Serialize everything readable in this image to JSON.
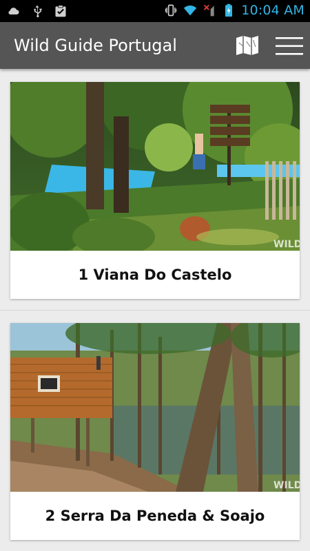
{
  "status_bar": {
    "time": "10:04 AM",
    "left_icons": [
      "cloud-icon",
      "usb-icon",
      "clipboard-check-icon"
    ],
    "right_icons": [
      "vibrate-icon",
      "wifi-icon",
      "no-signal-icon",
      "battery-charging-icon"
    ],
    "accent_color": "#33b5e5"
  },
  "app_bar": {
    "title": "Wild Guide Portugal",
    "background": "#555555",
    "actions": [
      "map-icon",
      "menu-icon"
    ]
  },
  "regions": [
    {
      "label": "1 Viana Do Castelo",
      "image_watermark": "WILD"
    },
    {
      "label": "2 Serra Da Peneda & Soajo",
      "image_watermark": "WILD"
    }
  ]
}
